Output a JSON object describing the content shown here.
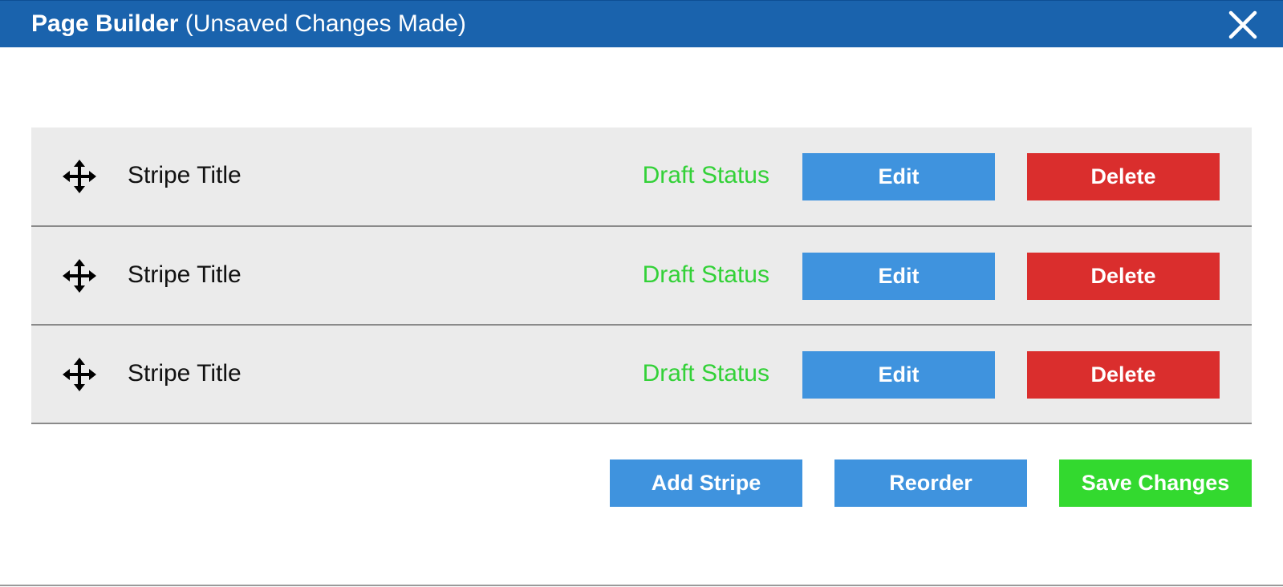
{
  "window": {
    "title_strong": "Page Builder",
    "title_status": "(Unsaved Changes Made)",
    "close_icon": "close-icon"
  },
  "stripes": [
    {
      "title": "Stripe Title",
      "status": "Draft Status",
      "edit_label": "Edit",
      "delete_label": "Delete"
    },
    {
      "title": "Stripe Title",
      "status": "Draft Status",
      "edit_label": "Edit",
      "delete_label": "Delete"
    },
    {
      "title": "Stripe Title",
      "status": "Draft Status",
      "edit_label": "Edit",
      "delete_label": "Delete"
    }
  ],
  "actions": {
    "add_label": "Add Stripe",
    "reorder_label": "Reorder",
    "save_label": "Save Changes"
  },
  "colors": {
    "header": "#1a63ad",
    "primary": "#3f93de",
    "danger": "#da2e2d",
    "success": "#33d92f",
    "status_text": "#33d138",
    "row_bg": "#ebebeb"
  },
  "icons": {
    "drag": "move-arrows-icon",
    "close": "close-icon"
  }
}
